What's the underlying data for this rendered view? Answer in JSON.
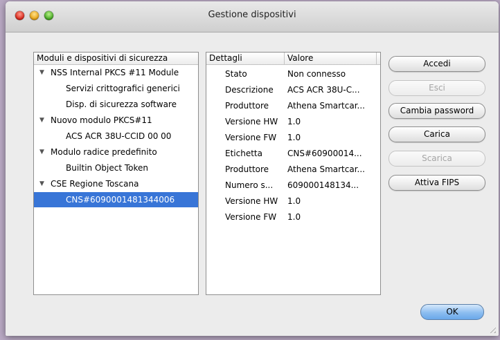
{
  "window": {
    "title": "Gestione dispositivi"
  },
  "tree": {
    "header": "Moduli e dispositivi di sicurezza",
    "items": [
      {
        "label": "NSS Internal PKCS #11 Module",
        "expanded": true,
        "level": 0
      },
      {
        "label": "Servizi crittografici generici",
        "level": 1
      },
      {
        "label": "Disp. di sicurezza software",
        "level": 1
      },
      {
        "label": "Nuovo modulo PKCS#11",
        "expanded": true,
        "level": 0
      },
      {
        "label": "ACS ACR 38U-CCID 00 00",
        "level": 1
      },
      {
        "label": "Modulo radice predefinito",
        "expanded": true,
        "level": 0
      },
      {
        "label": "Builtin Object Token",
        "level": 1
      },
      {
        "label": "CSE Regione Toscana",
        "expanded": true,
        "level": 0
      },
      {
        "label": "CNS#6090001481344006",
        "level": 1,
        "selected": true
      }
    ],
    "expander_glyph": "▼"
  },
  "details": {
    "col_key": "Dettagli",
    "col_value": "Valore",
    "rows": [
      {
        "k": "Stato",
        "v": "Non connesso"
      },
      {
        "k": "Descrizione",
        "v": "ACS ACR 38U-C..."
      },
      {
        "k": "Produttore",
        "v": "Athena Smartcar..."
      },
      {
        "k": "Versione HW",
        "v": "1.0"
      },
      {
        "k": "Versione FW",
        "v": "1.0"
      },
      {
        "k": "Etichetta",
        "v": "CNS#60900014..."
      },
      {
        "k": "Produttore",
        "v": "Athena Smartcar..."
      },
      {
        "k": "Numero s...",
        "v": "609000148134..."
      },
      {
        "k": "Versione HW",
        "v": "1.0"
      },
      {
        "k": "Versione FW",
        "v": "1.0"
      }
    ]
  },
  "buttons": {
    "accedi": "Accedi",
    "esci": "Esci",
    "cambia_password": "Cambia password",
    "carica": "Carica",
    "scarica": "Scarica",
    "attiva_fips": "Attiva FIPS",
    "ok": "OK"
  },
  "colors": {
    "selection": "#3875d7",
    "ok_button": "#8cbdf0"
  }
}
